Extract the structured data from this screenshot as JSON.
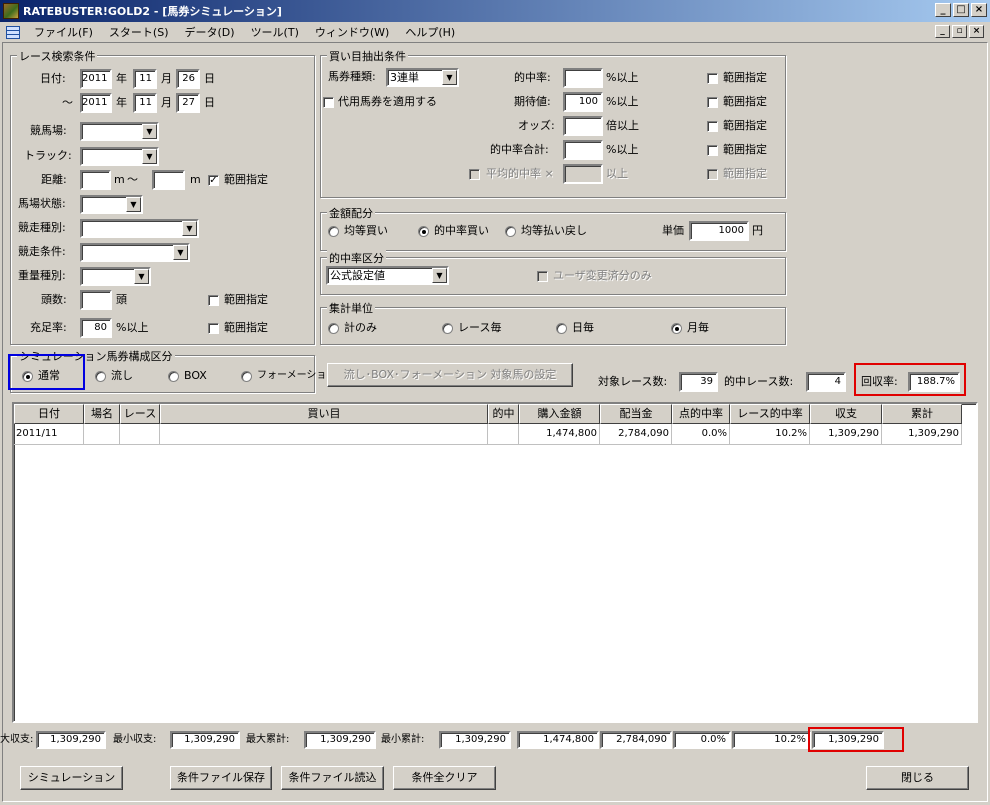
{
  "window": {
    "title": "RATEBUSTER!GOLD2 - [馬券シミュレーション]"
  },
  "menu": [
    "ファイル(F)",
    "スタート(S)",
    "データ(D)",
    "ツール(T)",
    "ウィンドウ(W)",
    "ヘルプ(H)"
  ],
  "race_search": {
    "title": "レース検索条件",
    "date_label": "日付:",
    "date_from": {
      "year": "2011",
      "month": "11",
      "day": "26"
    },
    "tilde": "～",
    "date_to": {
      "year": "2011",
      "month": "11",
      "day": "27"
    },
    "unit_year": "年",
    "unit_month": "月",
    "unit_day": "日",
    "racecourse_label": "競馬場:",
    "track_label": "トラック:",
    "distance_label": "距離:",
    "distance_unit": "m",
    "distance_sep": "～",
    "range_label": "範囲指定",
    "ground_label": "馬場状態:",
    "race_type_label": "競走種別:",
    "race_cond_label": "競走条件:",
    "weight_type_label": "重量種別:",
    "heads_label": "頭数:",
    "heads_unit": "頭",
    "fill_rate_label": "充足率:",
    "fill_rate_value": "80",
    "fill_rate_unit": "%以上"
  },
  "bet_extract": {
    "title": "買い目抽出条件",
    "bet_type_label": "馬券種類:",
    "bet_type_value": "3連単",
    "substitute_label": "代用馬券を適用する",
    "hit_rate_label": "的中率:",
    "hit_rate_unit": "%以上",
    "expect_label": "期待値:",
    "expect_value": "100",
    "expect_unit": "%以上",
    "odds_label": "オッズ:",
    "odds_unit": "倍以上",
    "hit_total_label": "的中率合計:",
    "hit_total_unit": "%以上",
    "avg_hit_label": "平均的中率 ×",
    "avg_hit_unit": "以上",
    "range_label": "範囲指定"
  },
  "allocation": {
    "title": "金額配分",
    "options": [
      "均等買い",
      "的中率買い",
      "均等払い戻し"
    ],
    "selected": "的中率買い",
    "unit_price_label": "単価",
    "unit_price_value": "1000",
    "unit_price_unit": "円"
  },
  "hit_class": {
    "title": "的中率区分",
    "value": "公式設定値",
    "user_changed_label": "ユーザ変更済分のみ"
  },
  "aggregate": {
    "title": "集計単位",
    "options": [
      "計のみ",
      "レース毎",
      "日毎",
      "月毎"
    ],
    "selected": "月毎"
  },
  "sim_type": {
    "title": "シミュレーション馬券構成区分",
    "options": [
      "通常",
      "流し",
      "BOX",
      "フォーメーション"
    ],
    "selected": "通常"
  },
  "target_button": "流し･BOX･フォーメーション 対象馬の設定",
  "stats": {
    "target_races_label": "対象レース数:",
    "target_races": "39",
    "hit_races_label": "的中レース数:",
    "hit_races": "4",
    "recovery_label": "回収率:",
    "recovery": "188.7%"
  },
  "table": {
    "headers": [
      "日付",
      "場名",
      "レース",
      "買い目",
      "的中",
      "購入金額",
      "配当金",
      "点的中率",
      "レース的中率",
      "収支",
      "累計"
    ],
    "rows": [
      [
        "2011/11",
        "",
        "",
        "",
        "",
        "1,474,800",
        "2,784,090",
        "0.0%",
        "10.2%",
        "1,309,290",
        "1,309,290"
      ]
    ]
  },
  "footer": {
    "max_balance_label": "大収支:",
    "max_balance": "1,309,290",
    "min_balance_label": "最小収支:",
    "min_balance": "1,309,290",
    "max_cum_label": "最大累計:",
    "max_cum": "1,309,290",
    "min_cum_label": "最小累計:",
    "min_cum": "1,309,290",
    "purchase": "1,474,800",
    "payout": "2,784,090",
    "point_hit": "0.0%",
    "race_hit": "10.2%",
    "balance": "1,309,290"
  },
  "buttons": {
    "simulate": "シミュレーション",
    "save": "条件ファイル保存",
    "load": "条件ファイル読込",
    "clear": "条件全クリア",
    "close": "閉じる"
  },
  "colors": {
    "highlight_red": "#e00000",
    "highlight_blue": "#0000e0",
    "titlebar": "#0a246a"
  }
}
